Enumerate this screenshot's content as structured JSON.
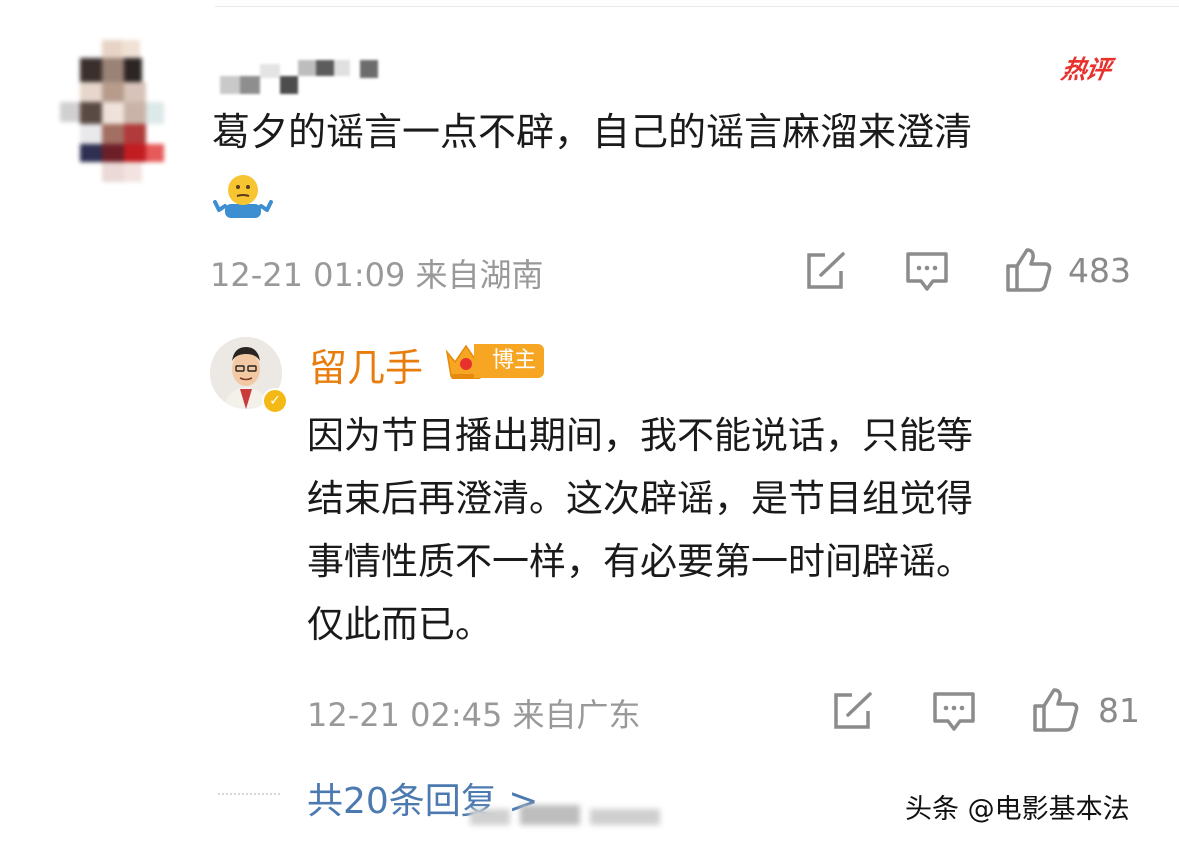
{
  "comment": {
    "hot_badge": "热评",
    "text": "葛夕的谣言一点不辟，自己的谣言麻溜来澄清",
    "emoji": "shrug-emoji",
    "time": "12-21 01:09",
    "location": "来自湖南",
    "likes": "483"
  },
  "reply": {
    "author": "留几手",
    "badge": "博主",
    "lines": [
      "因为节目播出期间，我不能说话，只能等",
      "结束后再澄清。这次辟谣，是节目组觉得",
      "事情性质不一样，有必要第一时间辟谣。",
      "仅此而已。"
    ],
    "time": "12-21 02:45",
    "location": "来自广东",
    "likes": "81"
  },
  "more_replies": "共20条回复 >",
  "watermark": "头条 @电影基本法",
  "colors": {
    "author": "#e87d0d",
    "hot": "#e8312d",
    "link": "#4c7ab0",
    "meta": "#999999",
    "badge": "#f6a623"
  },
  "icons": [
    "repost-icon",
    "comment-icon",
    "like-icon",
    "crown-icon",
    "verified-icon"
  ]
}
